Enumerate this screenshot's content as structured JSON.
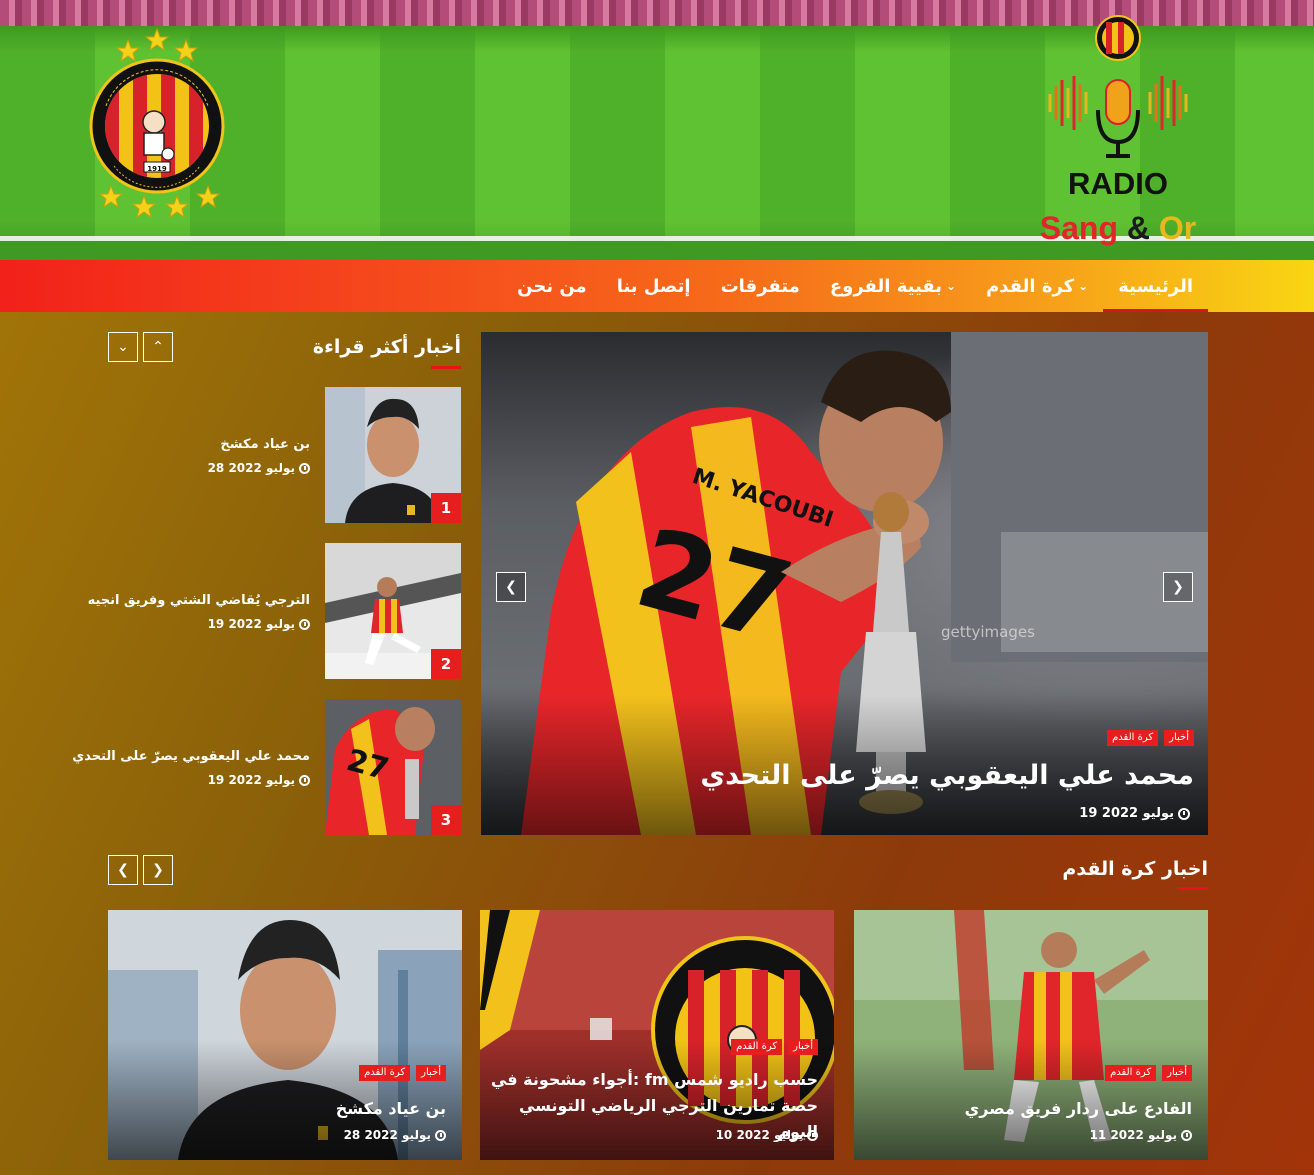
{
  "brand": {
    "radio": "RADIO",
    "sang": "Sang",
    "amp": "&",
    "or": "Or"
  },
  "nav": {
    "items": [
      {
        "label": "الرئيسية",
        "active": true,
        "dropdown": false
      },
      {
        "label": "كرة القدم",
        "active": false,
        "dropdown": true
      },
      {
        "label": "بقيية الفروع",
        "active": false,
        "dropdown": true
      },
      {
        "label": "متفرقات",
        "active": false,
        "dropdown": false
      },
      {
        "label": "إتصل بنا",
        "active": false,
        "dropdown": false
      },
      {
        "label": "من نحن",
        "active": false,
        "dropdown": false
      }
    ]
  },
  "hero": {
    "badges": [
      "أخبار",
      "كرة القدم"
    ],
    "title": "محمد علي اليعقوبي يصرّ على التحدي",
    "date": "19 يوليو 2022"
  },
  "most_read": {
    "title": "أخبار أكثر قراءة",
    "items": [
      {
        "rank": "1",
        "title": "بن عياد مكشخ",
        "date": "28 يوليو 2022"
      },
      {
        "rank": "2",
        "title": "الترجي يُقاضي الشتي وفريق انجيه",
        "date": "19 يوليو 2022"
      },
      {
        "rank": "3",
        "title": "محمد علي اليعقوبي يصرّ على التحدي",
        "date": "19 يوليو 2022"
      }
    ]
  },
  "football": {
    "title": "اخبار كرة القدم",
    "cards": [
      {
        "badges": [
          "أخبار",
          "كرة القدم"
        ],
        "title": "الفادع على ردار فريق مصري",
        "date": "11 يوليو 2022"
      },
      {
        "badges": [
          "أخبار",
          "كرة القدم"
        ],
        "title": "حسب راديو شمس fm :أجواء مشحونة في حصة تمارين الترجي الرياضي التونسي اليوم",
        "date": "10 يوليو 2022"
      },
      {
        "badges": [
          "أخبار",
          "كرة القدم"
        ],
        "title": "بن عياد مكشخ",
        "date": "28 يوليو 2022"
      }
    ]
  },
  "icons": {
    "clock": "clock-icon",
    "chevron_left": "chevron-left-icon",
    "chevron_right": "chevron-right-icon",
    "chevron_up": "chevron-up-icon",
    "chevron_down": "chevron-down-icon"
  },
  "colors": {
    "accent_red": "#e61e1e",
    "nav_start": "#f2211a",
    "nav_end": "#f9d612",
    "club_red": "#e0262a",
    "club_gold": "#e5b81d"
  }
}
